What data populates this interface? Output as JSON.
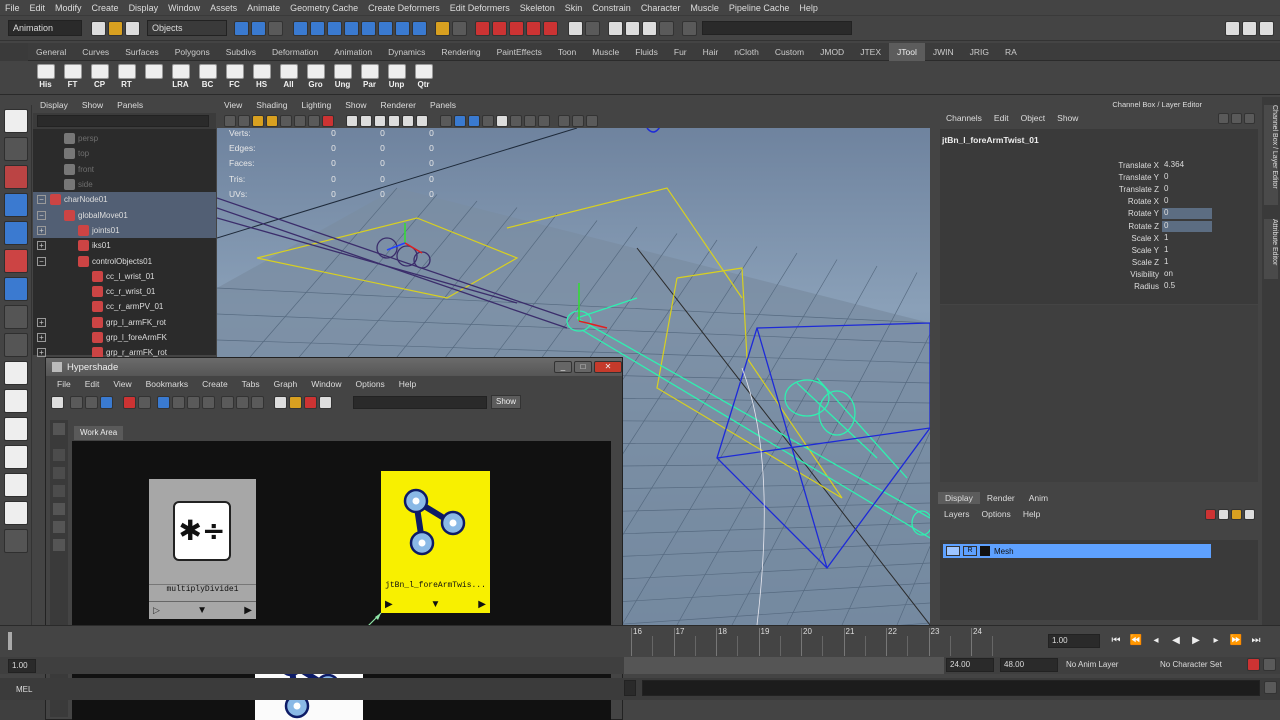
{
  "menubar": [
    "File",
    "Edit",
    "Modify",
    "Create",
    "Display",
    "Window",
    "Assets",
    "Animate",
    "Geometry Cache",
    "Create Deformers",
    "Edit Deformers",
    "Skeleton",
    "Skin",
    "Constrain",
    "Character",
    "Muscle",
    "Pipeline Cache",
    "Help"
  ],
  "status": {
    "mode": "Animation",
    "selection_mode": "Objects"
  },
  "shelf_tabs": [
    "General",
    "Curves",
    "Surfaces",
    "Polygons",
    "Subdivs",
    "Deformation",
    "Animation",
    "Dynamics",
    "Rendering",
    "PaintEffects",
    "Toon",
    "Muscle",
    "Fluids",
    "Fur",
    "Hair",
    "nCloth",
    "Custom",
    "JMOD",
    "JTEX",
    "JTool",
    "JWIN",
    "JRIG",
    "RA"
  ],
  "shelf_active": "JTool",
  "shelf_buttons": [
    "His",
    "FT",
    "CP",
    "RT",
    "",
    "LRA",
    "BC",
    "FC",
    "HS",
    "All",
    "Gro",
    "Ung",
    "Par",
    "Unp",
    "Qtr"
  ],
  "outliner": {
    "menu": [
      "Display",
      "Show",
      "Panels"
    ],
    "items": [
      {
        "label": "persp",
        "indent": 40,
        "dim": true,
        "expand": ""
      },
      {
        "label": "top",
        "indent": 40,
        "dim": true,
        "expand": ""
      },
      {
        "label": "front",
        "indent": 40,
        "dim": true,
        "expand": ""
      },
      {
        "label": "side",
        "indent": 40,
        "dim": true,
        "expand": ""
      },
      {
        "label": "charNode01",
        "indent": 26,
        "dim": false,
        "expand": "−",
        "sel": true
      },
      {
        "label": "globalMove01",
        "indent": 40,
        "dim": false,
        "expand": "−",
        "sel": true
      },
      {
        "label": "joints01",
        "indent": 54,
        "dim": false,
        "expand": "+",
        "sel": true
      },
      {
        "label": "iks01",
        "indent": 54,
        "dim": false,
        "expand": "+"
      },
      {
        "label": "controlObjects01",
        "indent": 54,
        "dim": false,
        "expand": "−"
      },
      {
        "label": "cc_l_wrist_01",
        "indent": 68,
        "dim": false,
        "expand": ""
      },
      {
        "label": "cc_r_wrist_01",
        "indent": 68,
        "dim": false,
        "expand": ""
      },
      {
        "label": "cc_r_armPV_01",
        "indent": 68,
        "dim": false,
        "expand": ""
      },
      {
        "label": "grp_l_armFK_rot",
        "indent": 68,
        "dim": false,
        "expand": "+"
      },
      {
        "label": "grp_l_foreArmFK",
        "indent": 68,
        "dim": false,
        "expand": "+"
      },
      {
        "label": "grp_r_armFK_rot",
        "indent": 68,
        "dim": false,
        "expand": "+"
      }
    ]
  },
  "viewport": {
    "menu": [
      "View",
      "Shading",
      "Lighting",
      "Show",
      "Renderer",
      "Panels"
    ],
    "hud": [
      {
        "label": "Verts:",
        "v": [
          "0",
          "0",
          "0"
        ]
      },
      {
        "label": "Edges:",
        "v": [
          "0",
          "0",
          "0"
        ]
      },
      {
        "label": "Faces:",
        "v": [
          "0",
          "0",
          "0"
        ]
      },
      {
        "label": "Tris:",
        "v": [
          "0",
          "0",
          "0"
        ]
      },
      {
        "label": "UVs:",
        "v": [
          "0",
          "0",
          "0"
        ]
      }
    ]
  },
  "channelbox": {
    "title": "Channel Box / Layer Editor",
    "menu": [
      "Channels",
      "Edit",
      "Object",
      "Show"
    ],
    "object": "jtBn_l_foreArmTwist_01",
    "attrs": [
      {
        "label": "Translate X",
        "value": "4.364",
        "hl": false
      },
      {
        "label": "Translate Y",
        "value": "0",
        "hl": false
      },
      {
        "label": "Translate Z",
        "value": "0",
        "hl": false
      },
      {
        "label": "Rotate X",
        "value": "0",
        "hl": false
      },
      {
        "label": "Rotate Y",
        "value": "0",
        "hl": true
      },
      {
        "label": "Rotate Z",
        "value": "0",
        "hl": true
      },
      {
        "label": "Scale X",
        "value": "1",
        "hl": false
      },
      {
        "label": "Scale Y",
        "value": "1",
        "hl": false
      },
      {
        "label": "Scale Z",
        "value": "1",
        "hl": false
      },
      {
        "label": "Visibility",
        "value": "on",
        "hl": false
      },
      {
        "label": "Radius",
        "value": "0.5",
        "hl": false
      }
    ],
    "side_tabs": [
      "Channel Box / Layer Editor",
      "Attribute Editor"
    ]
  },
  "layers": {
    "tabs": [
      "Display",
      "Render",
      "Anim"
    ],
    "menu": [
      "Layers",
      "Options",
      "Help"
    ],
    "rows": [
      {
        "name": "Mesh",
        "r": "R"
      }
    ]
  },
  "hypershade": {
    "title": "Hypershade",
    "menu": [
      "File",
      "Edit",
      "View",
      "Bookmarks",
      "Create",
      "Tabs",
      "Graph",
      "Window",
      "Options",
      "Help"
    ],
    "show_button": "Show",
    "tab": "Work Area",
    "nodes": {
      "multiply": "multiplyDivide1",
      "joint": "jtBn_l_foreArmTwis..."
    }
  },
  "timeline": {
    "ticks": [
      "16",
      "17",
      "18",
      "19",
      "20",
      "21",
      "22",
      "23",
      "24"
    ],
    "current": "1.00"
  },
  "range": {
    "start": "1.00",
    "end": "24.00",
    "end2": "48.00",
    "anim_layer": "No Anim Layer",
    "char_set": "No Character Set"
  },
  "cmd": {
    "label": "MEL"
  },
  "colors": {
    "ui_bg": "#444444",
    "selected": "#525f74",
    "layer_sel": "#5ea1ff",
    "node_yellow": "#f8f000",
    "wire_green": "#2ff0b0",
    "wire_blue": "#1d2ad8"
  }
}
